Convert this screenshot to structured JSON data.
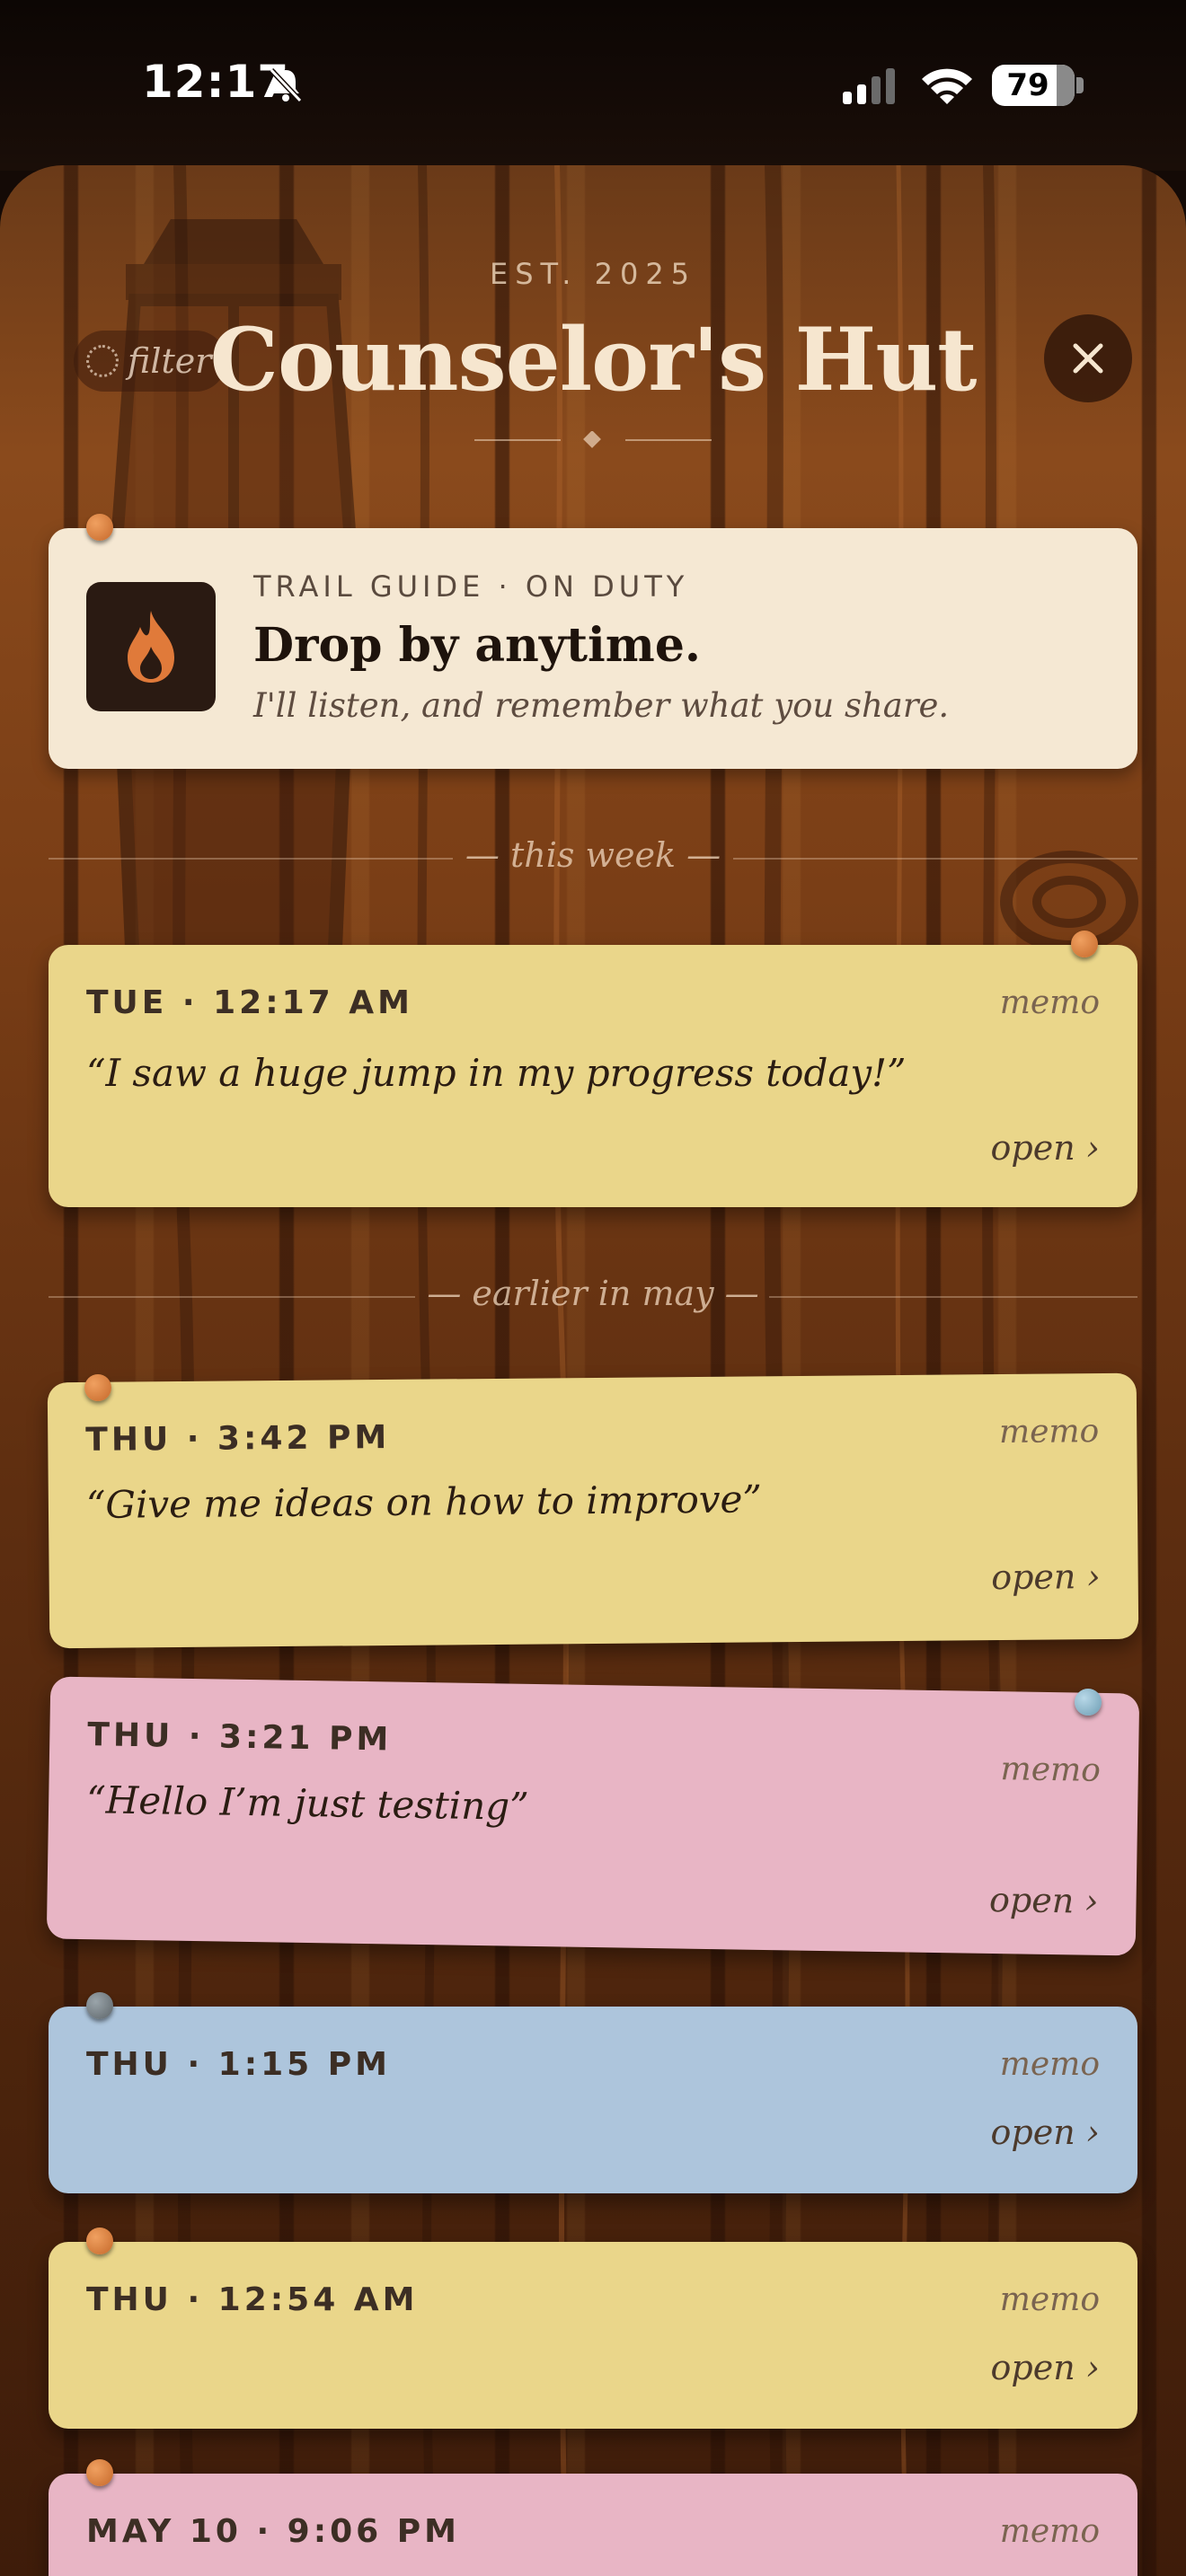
{
  "status_bar": {
    "time": "12:17",
    "battery": "79",
    "icons": [
      "bell-slash-icon",
      "signal-icon",
      "wifi-icon",
      "battery-icon"
    ]
  },
  "header": {
    "eyebrow": "EST. 2025",
    "title": "Counselor's Hut",
    "filter_label": "filter"
  },
  "guide_card": {
    "eyebrow": "TRAIL GUIDE · ON DUTY",
    "headline": "Drop by anytime.",
    "subtitle": "I'll listen, and remember what you share.",
    "icon": "flame-icon"
  },
  "sections": {
    "this_week": "— this week —",
    "earlier": "— earlier in may —"
  },
  "memos": [
    {
      "date": "TUE · 12:17 AM",
      "tag": "memo",
      "quote": "“I saw a huge jump in my progress today!”",
      "open": "open ›",
      "color": "#ead68a"
    },
    {
      "date": "THU · 3:42 PM",
      "tag": "memo",
      "quote": "“Give me ideas on how to improve”",
      "open": "open ›",
      "color": "#ead68a"
    },
    {
      "date": "THU · 3:21 PM",
      "tag": "memo",
      "quote": "“Hello I’m just testing”",
      "open": "open ›",
      "color": "#e8b5c5"
    },
    {
      "date": "THU · 1:15 PM",
      "tag": "memo",
      "quote": "",
      "open": "open ›",
      "color": "#adc5dc"
    },
    {
      "date": "THU · 12:54 AM",
      "tag": "memo",
      "quote": "",
      "open": "open ›",
      "color": "#ead68a"
    },
    {
      "date": "MAY 10 · 9:06 PM",
      "tag": "memo",
      "quote": "",
      "open": "",
      "color": "#e8b5c5"
    }
  ],
  "colors": {
    "accent_orange": "#d0723a",
    "card_cream": "#f5e8d3",
    "title_cream": "#f6e6cf"
  }
}
